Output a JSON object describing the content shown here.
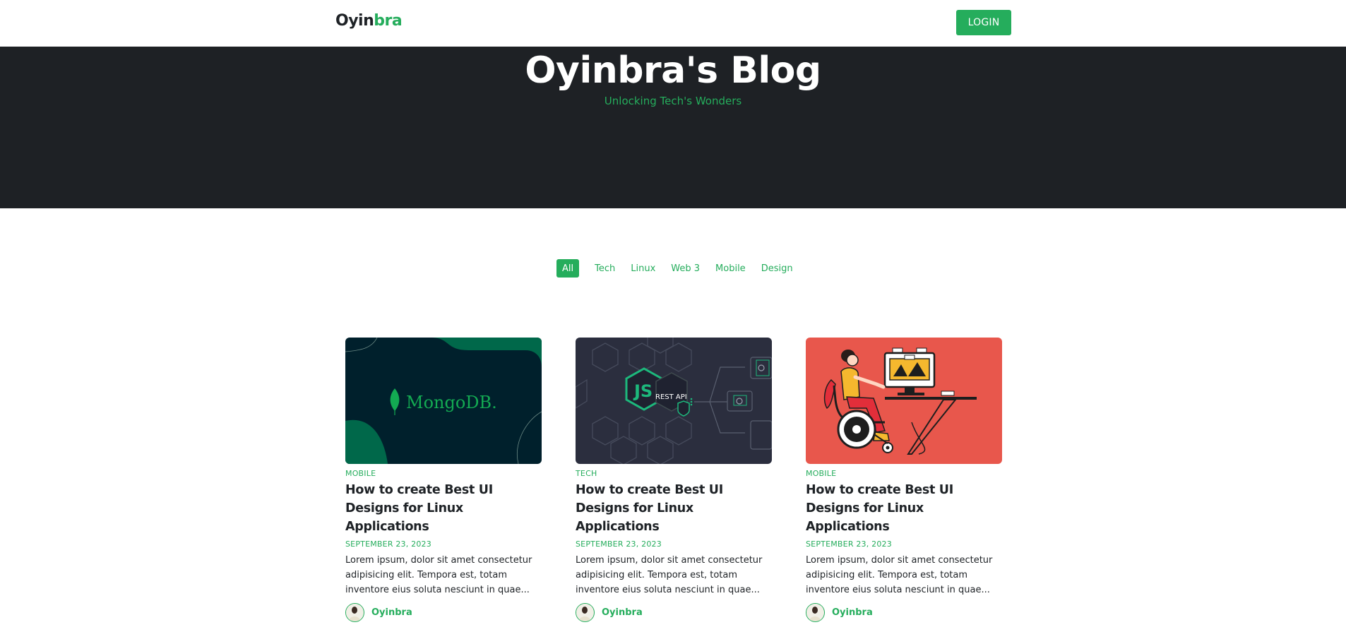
{
  "brand": {
    "logo_main": "Oyin",
    "logo_accent": "bra"
  },
  "nav": {
    "login_label": "LOGIN"
  },
  "hero": {
    "title": "Oyinbra's Blog",
    "subtitle": "Unlocking Tech's Wonders"
  },
  "filters": [
    {
      "label": "All",
      "active": true
    },
    {
      "label": "Tech",
      "active": false
    },
    {
      "label": "Linux",
      "active": false
    },
    {
      "label": "Web 3",
      "active": false
    },
    {
      "label": "Mobile",
      "active": false
    },
    {
      "label": "Design",
      "active": false
    }
  ],
  "posts": [
    {
      "category": "MOBILE",
      "title": "How to create Best UI Designs for Linux Applications",
      "date": "SEPTEMBER 23, 2023",
      "excerpt": "Lorem ipsum, dolor sit amet consectetur adipisicing elit. Tempora est, totam inventore eius soluta nesciunt in quae...",
      "author": "Oyinbra",
      "image": {
        "label": "MongoDB.",
        "theme": "mongodb"
      }
    },
    {
      "category": "TECH",
      "title": "How to create Best UI Designs for Linux Applications",
      "date": "SEPTEMBER 23, 2023",
      "excerpt": "Lorem ipsum, dolor sit amet consectetur adipisicing elit. Tempora est, totam inventore eius soluta nesciunt in quae...",
      "author": "Oyinbra",
      "image": {
        "label": "REST API",
        "theme": "nodejs-rest-api"
      }
    },
    {
      "category": "MOBILE",
      "title": "How to create Best UI Designs for Linux Applications",
      "date": "SEPTEMBER 23, 2023",
      "excerpt": "Lorem ipsum, dolor sit amet consectetur adipisicing elit. Tempora est, totam inventore eius soluta nesciunt in quae...",
      "author": "Oyinbra",
      "image": {
        "label": "",
        "theme": "wheelchair-designer-illustration"
      }
    }
  ],
  "colors": {
    "accent": "#25ad5c",
    "hero_bg": "#1e2125",
    "text": "#1e2226"
  }
}
